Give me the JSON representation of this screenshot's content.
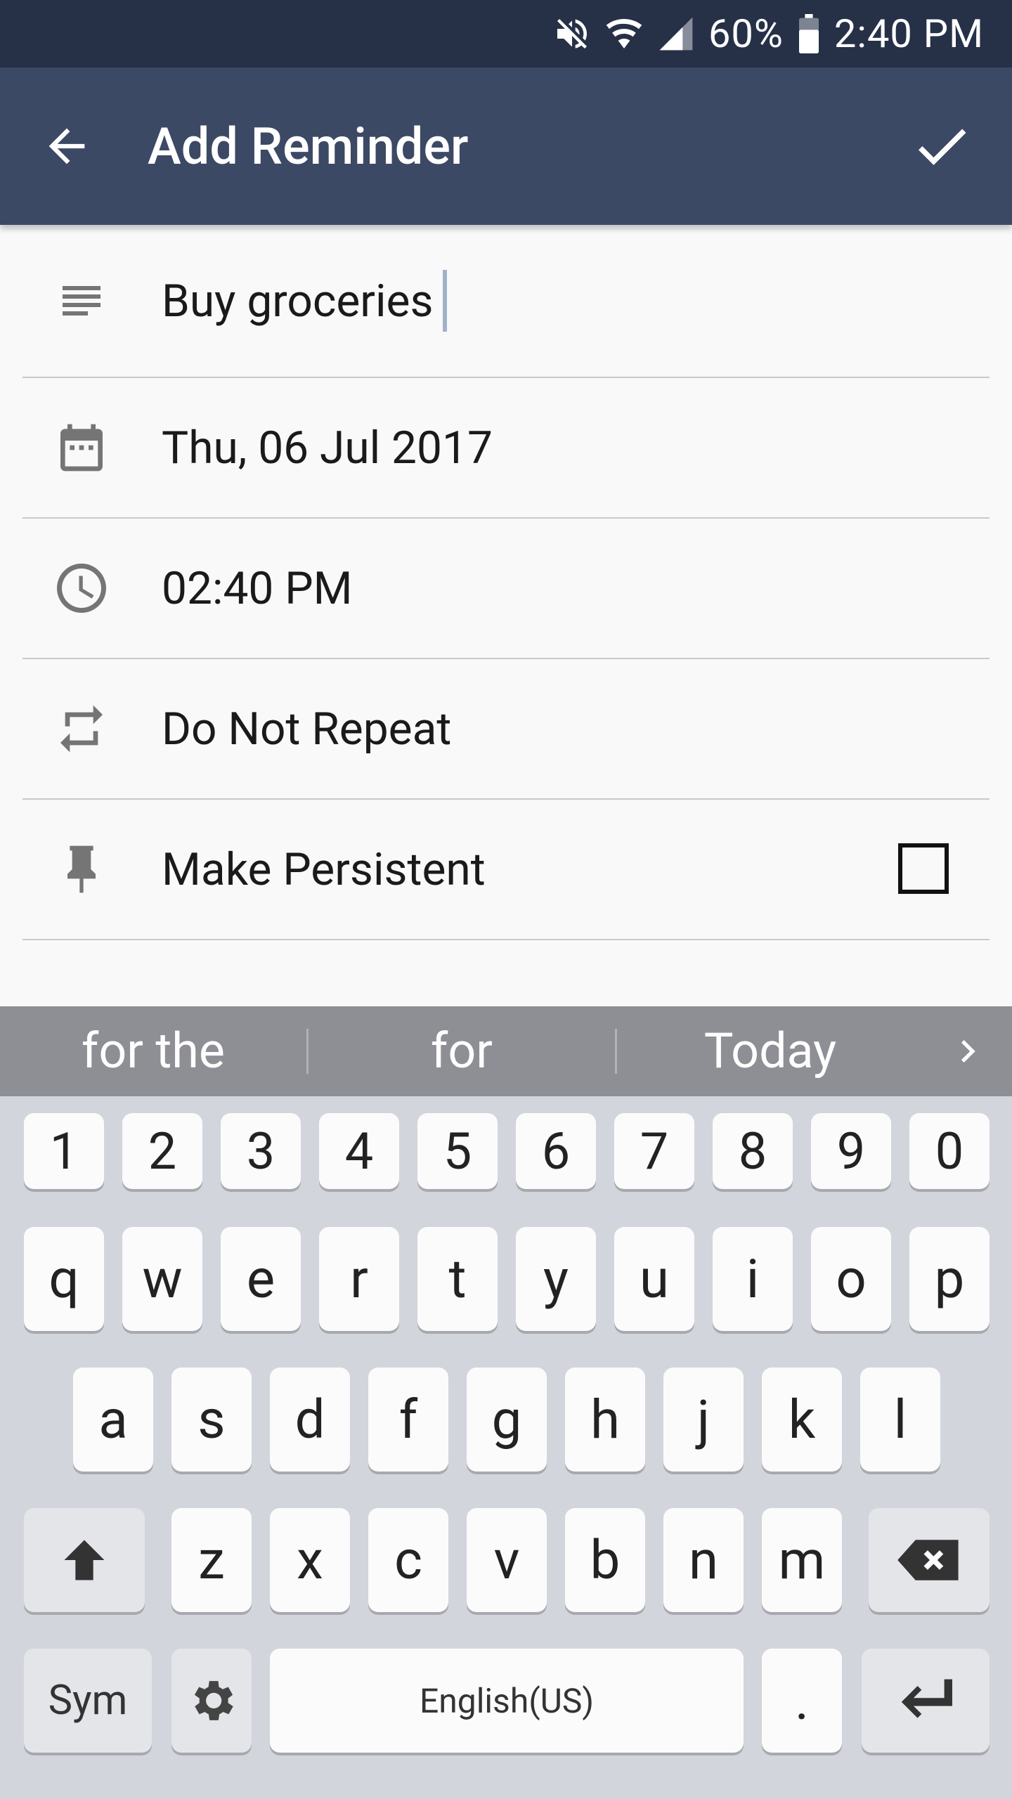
{
  "status_bar": {
    "battery": "60%",
    "time": "2:40 PM",
    "icons": [
      "mute-icon",
      "wifi-icon",
      "signal-icon",
      "battery-icon"
    ]
  },
  "app_bar": {
    "title": "Add Reminder",
    "back_icon": "arrow-back-icon",
    "confirm_icon": "checkmark-icon"
  },
  "form": {
    "title_value": "Buy groceries",
    "date": "Thu, 06 Jul 2017",
    "time": "02:40 PM",
    "repeat": "Do Not Repeat",
    "persistent_label": "Make Persistent",
    "persistent_checked": false
  },
  "keyboard": {
    "suggestions": [
      "for the",
      "for",
      "Today"
    ],
    "number_row": [
      "1",
      "2",
      "3",
      "4",
      "5",
      "6",
      "7",
      "8",
      "9",
      "0"
    ],
    "row1": [
      "q",
      "w",
      "e",
      "r",
      "t",
      "y",
      "u",
      "i",
      "o",
      "p"
    ],
    "row2": [
      "a",
      "s",
      "d",
      "f",
      "g",
      "h",
      "j",
      "k",
      "l"
    ],
    "row3": [
      "z",
      "x",
      "c",
      "v",
      "b",
      "n",
      "m"
    ],
    "sym_label": "Sym",
    "space_label": "English(US)",
    "period_label": "."
  },
  "colors": {
    "status_bar": "#263148",
    "app_bar": "#3c4965",
    "suggestion_bar": "#8e8e95",
    "keyboard_bg": "#d3d5dc"
  }
}
